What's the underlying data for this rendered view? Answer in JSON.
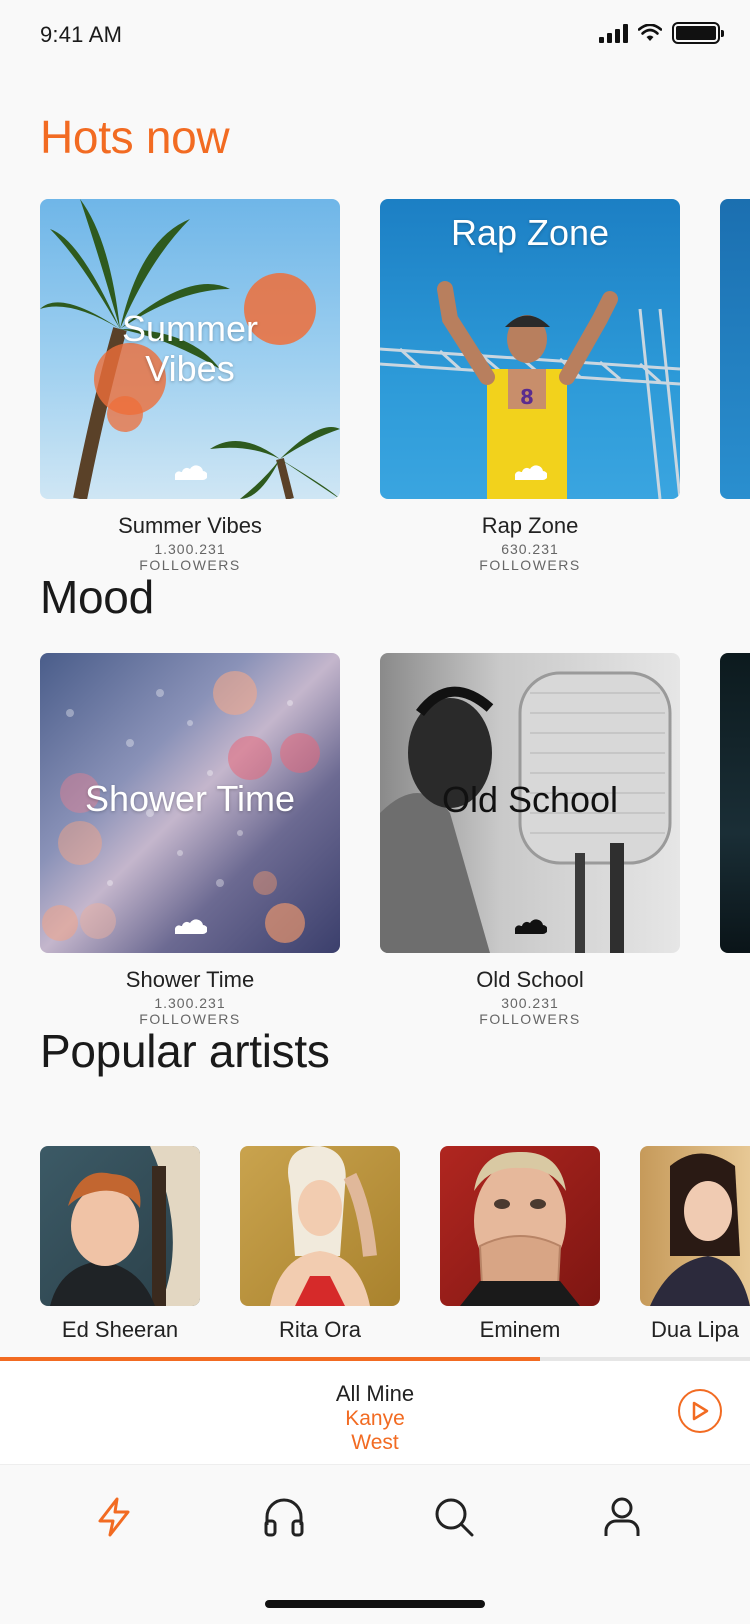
{
  "status_bar": {
    "time": "9:41 AM"
  },
  "sections": {
    "hots_now": "Hots now",
    "mood": "Mood",
    "popular_artists": "Popular artists"
  },
  "hots": [
    {
      "overlay": "Summer\nVibes",
      "name": "Summer Vibes",
      "count": "1.300.231",
      "followers": "FOLLOWERS"
    },
    {
      "overlay": "Rap Zone",
      "name": "Rap Zone",
      "count": "630.231",
      "followers": "FOLLOWERS"
    }
  ],
  "mood": [
    {
      "overlay": "Shower Time",
      "name": "Shower Time",
      "count": "1.300.231",
      "followers": "FOLLOWERS"
    },
    {
      "overlay": "Old School",
      "name": "Old School",
      "count": "300.231",
      "followers": "FOLLOWERS"
    }
  ],
  "artists": [
    {
      "name": "Ed Sheeran"
    },
    {
      "name": "Rita Ora"
    },
    {
      "name": "Eminem"
    },
    {
      "name": "Dua Lipa"
    }
  ],
  "player": {
    "title": "All Mine",
    "artist": "Kanye West",
    "progress": 0.72
  },
  "tabs": [
    "lightning-icon",
    "headphones-icon",
    "search-icon",
    "profile-icon"
  ],
  "colors": {
    "accent": "#f26b22",
    "background": "#f9f9f9"
  }
}
